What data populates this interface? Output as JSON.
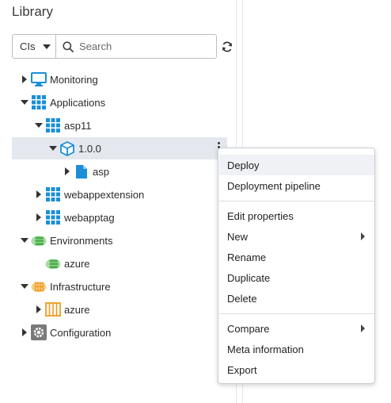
{
  "library": {
    "title": "Library",
    "type_filter": "CIs",
    "search_placeholder": "Search"
  },
  "tree": [
    {
      "label": "Monitoring",
      "icon": "monitor-icon",
      "expanded": false
    },
    {
      "label": "Applications",
      "icon": "applications-grid-icon",
      "expanded": true
    },
    {
      "label": "asp11",
      "icon": "application-grid-icon",
      "expanded": true
    },
    {
      "label": "1.0.0",
      "icon": "package-cube-icon",
      "expanded": true,
      "selected": true
    },
    {
      "label": "asp",
      "icon": "file-icon",
      "expanded": false
    },
    {
      "label": "webappextension",
      "icon": "application-grid-icon",
      "expanded": false
    },
    {
      "label": "webapptag",
      "icon": "application-grid-icon",
      "expanded": false
    },
    {
      "label": "Environments",
      "icon": "environments-icon",
      "expanded": true
    },
    {
      "label": "azure",
      "icon": "environment-icon",
      "expanded": false
    },
    {
      "label": "Infrastructure",
      "icon": "infrastructure-icon",
      "expanded": true
    },
    {
      "label": "azure",
      "icon": "infrastructure-host-icon",
      "expanded": false
    },
    {
      "label": "Configuration",
      "icon": "gear-icon",
      "expanded": false
    }
  ],
  "context_menu": {
    "items": [
      {
        "label": "Deploy"
      },
      {
        "label": "Deployment pipeline"
      },
      {
        "label": "Edit properties"
      },
      {
        "label": "New",
        "submenu": true
      },
      {
        "label": "Rename"
      },
      {
        "label": "Duplicate"
      },
      {
        "label": "Delete"
      },
      {
        "label": "Compare",
        "submenu": true
      },
      {
        "label": "Meta information"
      },
      {
        "label": "Export"
      }
    ]
  },
  "colors": {
    "primary_blue": "#1a8fd8",
    "env_green": "#5cb85c",
    "infra_orange": "#f0a030",
    "selected_row": "#e4e8ee"
  }
}
